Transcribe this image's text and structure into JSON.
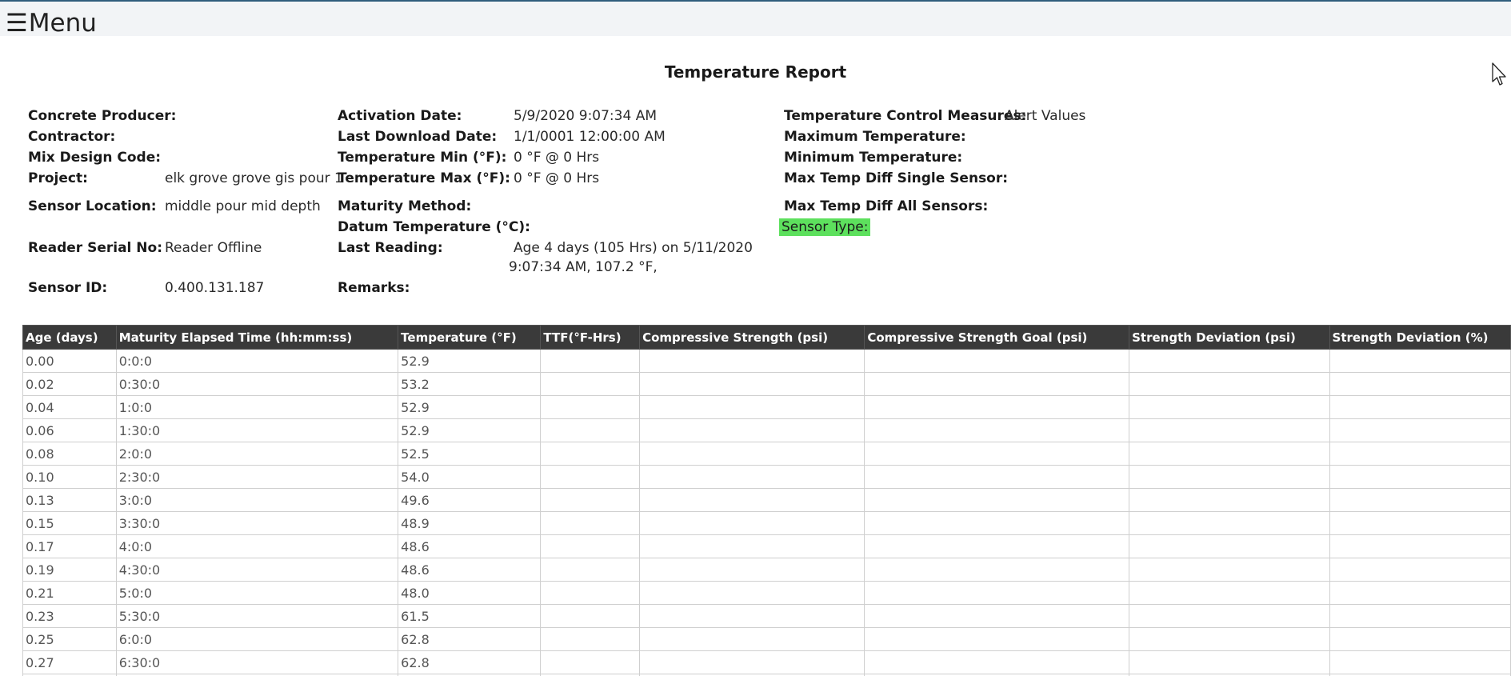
{
  "menu": {
    "icon": "hamburger-icon",
    "glyph": "☰",
    "label": "Menu"
  },
  "report": {
    "title": "Temperature Report"
  },
  "col1": {
    "concrete_producer": {
      "label": "Concrete Producer:",
      "value": ""
    },
    "contractor": {
      "label": "Contractor:",
      "value": ""
    },
    "mix_design_code": {
      "label": "Mix Design Code:",
      "value": ""
    },
    "project": {
      "label": "Project:",
      "value": "elk grove grove gis pour 1"
    },
    "sensor_location": {
      "label": "Sensor Location:",
      "value": "middle pour mid depth"
    },
    "reader_serial": {
      "label": "Reader Serial No:",
      "value": "Reader Offline"
    },
    "sensor_id": {
      "label": "Sensor ID:",
      "value": "0.400.131.187"
    }
  },
  "col2": {
    "activation_date": {
      "label": "Activation Date:",
      "value": "5/9/2020 9:07:34 AM"
    },
    "last_download_date": {
      "label": "Last Download Date:",
      "value": "1/1/0001 12:00:00 AM"
    },
    "temp_min": {
      "label": "Temperature Min (°F):",
      "value": "0 °F @ 0 Hrs"
    },
    "temp_max": {
      "label": "Temperature Max (°F):",
      "value": "0 °F @ 0 Hrs"
    },
    "maturity_method": {
      "label": "Maturity Method:",
      "value": ""
    },
    "datum_temperature": {
      "label": "Datum Temperature (°C):",
      "value": ""
    },
    "last_reading": {
      "label": "Last Reading:",
      "value_line1": "Age 4 days (105 Hrs) on 5/11/2020",
      "value_line2": "9:07:34 AM, 107.2 °F,"
    },
    "remarks": {
      "label": "Remarks:",
      "value": ""
    }
  },
  "col3": {
    "control_measures": {
      "label": "Temperature Control Measures:",
      "value": "Alert Values"
    },
    "max_temperature": {
      "label": "Maximum Temperature:",
      "value": ""
    },
    "min_temperature": {
      "label": "Minimum Temperature:",
      "value": ""
    },
    "max_diff_single": {
      "label": "Max Temp Diff Single Sensor:",
      "value": ""
    },
    "max_diff_all": {
      "label": "Max Temp Diff All Sensors:",
      "value": ""
    },
    "sensor_type": {
      "label": "Sensor Type:",
      "value": ""
    }
  },
  "highlight_color": "#5de05d",
  "header_color": "#3a3a3a",
  "table": {
    "columns": [
      "Age (days)",
      "Maturity Elapsed Time (hh:mm:ss)",
      "Temperature (°F)",
      "TTF(°F-Hrs)",
      "Compressive Strength (psi)",
      "Compressive Strength Goal (psi)",
      "Strength Deviation (psi)",
      "Strength Deviation (%)"
    ],
    "rows": [
      [
        "0.00",
        "0:0:0",
        "52.9",
        "",
        "",
        "",
        "",
        ""
      ],
      [
        "0.02",
        "0:30:0",
        "53.2",
        "",
        "",
        "",
        "",
        ""
      ],
      [
        "0.04",
        "1:0:0",
        "52.9",
        "",
        "",
        "",
        "",
        ""
      ],
      [
        "0.06",
        "1:30:0",
        "52.9",
        "",
        "",
        "",
        "",
        ""
      ],
      [
        "0.08",
        "2:0:0",
        "52.5",
        "",
        "",
        "",
        "",
        ""
      ],
      [
        "0.10",
        "2:30:0",
        "54.0",
        "",
        "",
        "",
        "",
        ""
      ],
      [
        "0.13",
        "3:0:0",
        "49.6",
        "",
        "",
        "",
        "",
        ""
      ],
      [
        "0.15",
        "3:30:0",
        "48.9",
        "",
        "",
        "",
        "",
        ""
      ],
      [
        "0.17",
        "4:0:0",
        "48.6",
        "",
        "",
        "",
        "",
        ""
      ],
      [
        "0.19",
        "4:30:0",
        "48.6",
        "",
        "",
        "",
        "",
        ""
      ],
      [
        "0.21",
        "5:0:0",
        "48.0",
        "",
        "",
        "",
        "",
        ""
      ],
      [
        "0.23",
        "5:30:0",
        "61.5",
        "",
        "",
        "",
        "",
        ""
      ],
      [
        "0.25",
        "6:0:0",
        "62.8",
        "",
        "",
        "",
        "",
        ""
      ],
      [
        "0.27",
        "6:30:0",
        "62.8",
        "",
        "",
        "",
        "",
        ""
      ],
      [
        "",
        "",
        "",
        "",
        "",
        "",
        "",
        ""
      ]
    ]
  }
}
